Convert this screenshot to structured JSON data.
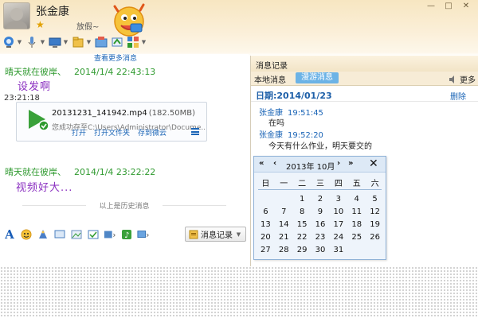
{
  "header": {
    "contact_name": "张金康",
    "status": "放假~"
  },
  "chat": {
    "history_notice": "查看更多消息",
    "messages": [
      {
        "sender": "晴天就在彼岸、",
        "date": "2014/1/4",
        "time": "22:43:13",
        "text": "设发啊"
      },
      {
        "sender": "晴天就在彼岸、",
        "date": "2014/1/4",
        "time": "23:22:22",
        "text": "视频好大..."
      }
    ],
    "file": {
      "time": "23:21:18",
      "name": "20131231_141942.mp4",
      "size": "(182.50MB)",
      "saved_to": "您成功存至C:\\Users\\Administrator\\Docume...",
      "actions": [
        "打开",
        "打开文件夹",
        "存到微云"
      ]
    },
    "history_divider": "以上是历史消息"
  },
  "input_toolbar": {
    "record_button": "消息记录"
  },
  "history_panel": {
    "title": "消息记录",
    "tab_local": "本地消息",
    "tab_roaming": "漫游消息",
    "more": "更多",
    "date_label": "日期:2014/01/23",
    "delete": "删除",
    "entries": [
      {
        "name": "张金康",
        "time": "19:51:45",
        "text": "在吗"
      },
      {
        "name": "张金康",
        "time": "19:52:20",
        "text": "今天有什么作业，明天要交的"
      }
    ]
  },
  "calendar": {
    "month_label": "2013年 10月",
    "prev_year": "«",
    "prev_month": "‹",
    "next_month": "›",
    "next_year": "»",
    "close": "✕",
    "weekdays": [
      "日",
      "一",
      "二",
      "三",
      "四",
      "五",
      "六"
    ],
    "days": [
      "",
      "",
      "1",
      "2",
      "3",
      "4",
      "5",
      "6",
      "7",
      "8",
      "9",
      "10",
      "11",
      "12",
      "13",
      "14",
      "15",
      "16",
      "17",
      "18",
      "19",
      "20",
      "21",
      "22",
      "23",
      "24",
      "25",
      "26",
      "27",
      "28",
      "29",
      "30",
      "31"
    ]
  },
  "colors": {
    "sender_green": "#2f9a2f",
    "message_purple": "#8a2fc0",
    "link_blue": "#1a64b6",
    "tab_active": "#6cb3e6"
  },
  "icons": {
    "toolbar": [
      "camera-icon",
      "microphone-icon",
      "remote-desktop-icon",
      "file-transfer-icon",
      "app-box-icon",
      "send-icon",
      "more-apps-icon"
    ],
    "input": [
      "font-icon",
      "emoji-icon",
      "magic-icon",
      "screen-icon",
      "image-icon",
      "screenshot-icon",
      "share-icon",
      "music-icon",
      "record-icon"
    ]
  }
}
